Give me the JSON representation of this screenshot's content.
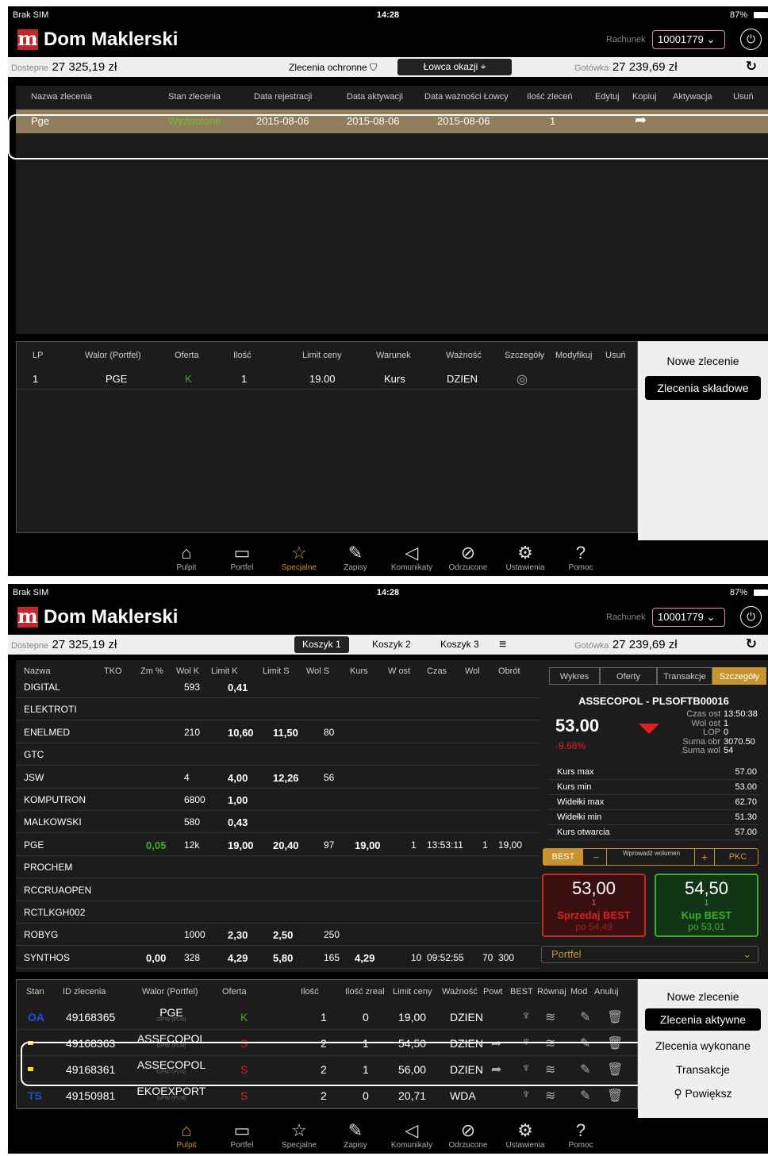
{
  "status": {
    "carrier": "Brak SIM",
    "time": "14:28",
    "battery": "87%"
  },
  "brand": {
    "name": "Dom Maklerski",
    "logo_letter": "m",
    "rachunek_label": "Rachunek",
    "rachunek_value": "10001779"
  },
  "balance": {
    "dostepne_label": "Dostepne",
    "dostepne_value": "27 325,19 zł",
    "gotowka_label": "Gotówka",
    "gotowka_value": "27 239,69 zł"
  },
  "screen1": {
    "zlecenia_ochronne": "Zlecenia ochronne",
    "lowca": "Łowca okazji",
    "top_headers": [
      "Nazwa zlecenia",
      "Stan zlecenia",
      "Data rejestracji",
      "Data aktywacji",
      "Data ważności Łowcy",
      "Ilość zleceń",
      "Edytuj",
      "Kopiuj",
      "Aktywacja",
      "Usuń"
    ],
    "top_row": {
      "name": "Pge",
      "stan": "Wyzwolone",
      "data_rej": "2015-08-06",
      "data_akt": "2015-08-06",
      "data_waz": "2015-08-06",
      "ilosc": "1"
    },
    "bottom_headers": [
      "LP",
      "Walor (Portfel)",
      "Oferta",
      "Ilość",
      "Limit ceny",
      "Warunek",
      "Ważność",
      "Szczegóły",
      "Modyfikuj",
      "Usuń"
    ],
    "bottom_row": {
      "lp": "1",
      "walor": "PGE",
      "oferta": "K",
      "ilosc": "1",
      "limit": "19.00",
      "warunek": "Kurs",
      "waznosc": "DZIEN"
    },
    "side": {
      "nowe": "Nowe zlecenie",
      "skladowe": "Zlecenia składowe"
    }
  },
  "nav": [
    {
      "label": "Pulpit",
      "icon": "home-icon"
    },
    {
      "label": "Portfel",
      "icon": "wallet-icon"
    },
    {
      "label": "Specjalne",
      "icon": "star-icon"
    },
    {
      "label": "Zapisy",
      "icon": "note-icon"
    },
    {
      "label": "Komunikaty",
      "icon": "megaphone-icon"
    },
    {
      "label": "Odrzucone",
      "icon": "rejected-icon"
    },
    {
      "label": "Ustawienia",
      "icon": "gear-icon"
    },
    {
      "label": "Pomoc",
      "icon": "help-icon"
    }
  ],
  "screen2": {
    "baskets": [
      "Koszyk 1",
      "Koszyk 2",
      "Koszyk 3"
    ],
    "watch_headers": [
      "Nazwa",
      "TKO",
      "Zm %",
      "Wol K",
      "Limit K",
      "Limit S",
      "Wol S",
      "Kurs",
      "W ost",
      "Czas",
      "Wol",
      "Obrót"
    ],
    "watch_rows": [
      {
        "nazwa": "DIGITAL",
        "zm": "",
        "wolk": "593",
        "limk": "0,41",
        "lims": "",
        "wols": "",
        "kurs": "",
        "wost": "",
        "czas": "",
        "wol": "",
        "obrot": ""
      },
      {
        "nazwa": "ELEKTROTI",
        "zm": "",
        "wolk": "",
        "limk": "",
        "lims": "",
        "wols": "",
        "kurs": "",
        "wost": "",
        "czas": "",
        "wol": "",
        "obrot": ""
      },
      {
        "nazwa": "ENELMED",
        "zm": "",
        "wolk": "210",
        "limk": "10,60",
        "lims": "11,50",
        "wols": "80",
        "kurs": "",
        "wost": "",
        "czas": "",
        "wol": "",
        "obrot": ""
      },
      {
        "nazwa": "GTC",
        "zm": "",
        "wolk": "",
        "limk": "",
        "lims": "",
        "wols": "",
        "kurs": "",
        "wost": "",
        "czas": "",
        "wol": "",
        "obrot": ""
      },
      {
        "nazwa": "JSW",
        "zm": "",
        "wolk": "4",
        "limk": "4,00",
        "lims": "12,26",
        "wols": "56",
        "kurs": "",
        "wost": "",
        "czas": "",
        "wol": "",
        "obrot": ""
      },
      {
        "nazwa": "KOMPUTRON",
        "zm": "",
        "wolk": "6800",
        "limk": "1,00",
        "lims": "",
        "wols": "",
        "kurs": "",
        "wost": "",
        "czas": "",
        "wol": "",
        "obrot": ""
      },
      {
        "nazwa": "MALKOWSKI",
        "zm": "",
        "wolk": "580",
        "limk": "0,43",
        "lims": "",
        "wols": "",
        "kurs": "",
        "wost": "",
        "czas": "",
        "wol": "",
        "obrot": ""
      },
      {
        "nazwa": "PGE",
        "zm": "0,05",
        "wolk": "12k",
        "limk": "19,00",
        "lims": "20,40",
        "wols": "97",
        "kurs": "19,00",
        "wost": "1",
        "czas": "13:53:11",
        "wol": "1",
        "obrot": "19,00"
      },
      {
        "nazwa": "PROCHEM",
        "zm": "",
        "wolk": "",
        "limk": "",
        "lims": "",
        "wols": "",
        "kurs": "",
        "wost": "",
        "czas": "",
        "wol": "",
        "obrot": ""
      },
      {
        "nazwa": "RCCRUAOPEN",
        "zm": "",
        "wolk": "",
        "limk": "",
        "lims": "",
        "wols": "",
        "kurs": "",
        "wost": "",
        "czas": "",
        "wol": "",
        "obrot": ""
      },
      {
        "nazwa": "RCTLKGH002",
        "zm": "",
        "wolk": "",
        "limk": "",
        "lims": "",
        "wols": "",
        "kurs": "",
        "wost": "",
        "czas": "",
        "wol": "",
        "obrot": ""
      },
      {
        "nazwa": "ROBYG",
        "zm": "",
        "wolk": "1000",
        "limk": "2,30",
        "lims": "2,50",
        "wols": "250",
        "kurs": "",
        "wost": "",
        "czas": "",
        "wol": "",
        "obrot": ""
      },
      {
        "nazwa": "SYNTHOS",
        "zm": "0,00",
        "wolk": "328",
        "limk": "4,29",
        "lims": "5,80",
        "wols": "165",
        "kurs": "4,29",
        "wost": "10",
        "czas": "09:52:55",
        "wol": "70",
        "obrot": "300"
      }
    ],
    "detail_tabs": [
      "Wykres",
      "Oferty",
      "Transakcje",
      "Szczegóły"
    ],
    "detail": {
      "title": "ASSECOPOL - PLSOFTB00016",
      "price": "53.00",
      "change": "-9.68%",
      "info": [
        [
          "Czas ost",
          "13:50:38"
        ],
        [
          "Wol ost",
          "1"
        ],
        [
          "LOP",
          "0"
        ],
        [
          "Suma obr",
          "3070.50"
        ],
        [
          "Suma wol",
          "54"
        ]
      ],
      "rows": [
        [
          "Kurs max",
          "57.00"
        ],
        [
          "Kurs min",
          "53.00"
        ],
        [
          "Widełki max",
          "62.70"
        ],
        [
          "Widełki min",
          "51.30"
        ],
        [
          "Kurs otwarcia",
          "57.00"
        ]
      ],
      "best": "BEST",
      "minus": "−",
      "wprowadz": "Wprowadź wolumen",
      "plus": "+",
      "pkc": "PKC",
      "sell": {
        "price": "53,00",
        "qty": "1",
        "label": "Sprzedaj BEST",
        "sub": "po 54,49"
      },
      "buy": {
        "price": "54,50",
        "qty": "1",
        "label": "Kup BEST",
        "sub": "po 53,01"
      },
      "portfel": "Portfel"
    },
    "order_headers": [
      "Stan",
      "ID zlecenia",
      "Walor (Portfel)",
      "Oferta",
      "Ilość",
      "Ilość zreal",
      "Limit ceny",
      "Ważność",
      "Powt",
      "BEST",
      "Równaj",
      "Mod",
      "Anuluj"
    ],
    "orders": [
      {
        "stan": "OA",
        "id": "49168365",
        "walor": "PGE",
        "sub": "GPW (PLN)",
        "oferta": "K",
        "ilosc": "1",
        "zreal": "0",
        "limit": "19,00",
        "waznosc": "DZIEN"
      },
      {
        "stan": "",
        "id": "49168363",
        "walor": "ASSECOPOL",
        "sub": "GPW (PLN)",
        "oferta": "S",
        "ilosc": "2",
        "zreal": "1",
        "limit": "54,50",
        "waznosc": "DZIEN"
      },
      {
        "stan": "",
        "id": "49168361",
        "walor": "ASSECOPOL",
        "sub": "GPW (PLN)",
        "oferta": "S",
        "ilosc": "2",
        "zreal": "1",
        "limit": "56,00",
        "waznosc": "DZIEN"
      },
      {
        "stan": "TS",
        "id": "49150981",
        "walor": "EKOEXPORT",
        "sub": "GPW (PLN)",
        "oferta": "S",
        "ilosc": "2",
        "zreal": "0",
        "limit": "20,71",
        "waznosc": "WDA"
      }
    ],
    "side": {
      "nowe": "Nowe zlecenie",
      "aktywne": "Zlecenia aktywne",
      "wykonane": "Zlecenia wykonane",
      "transakcje": "Transakcje",
      "powieksz": "Powiększ"
    }
  },
  "colors": {
    "accent": "#c7932f",
    "highlight_row": "#8f7d5d",
    "green": "#3fae29",
    "red": "#e02020",
    "brand": "#c1272d"
  }
}
